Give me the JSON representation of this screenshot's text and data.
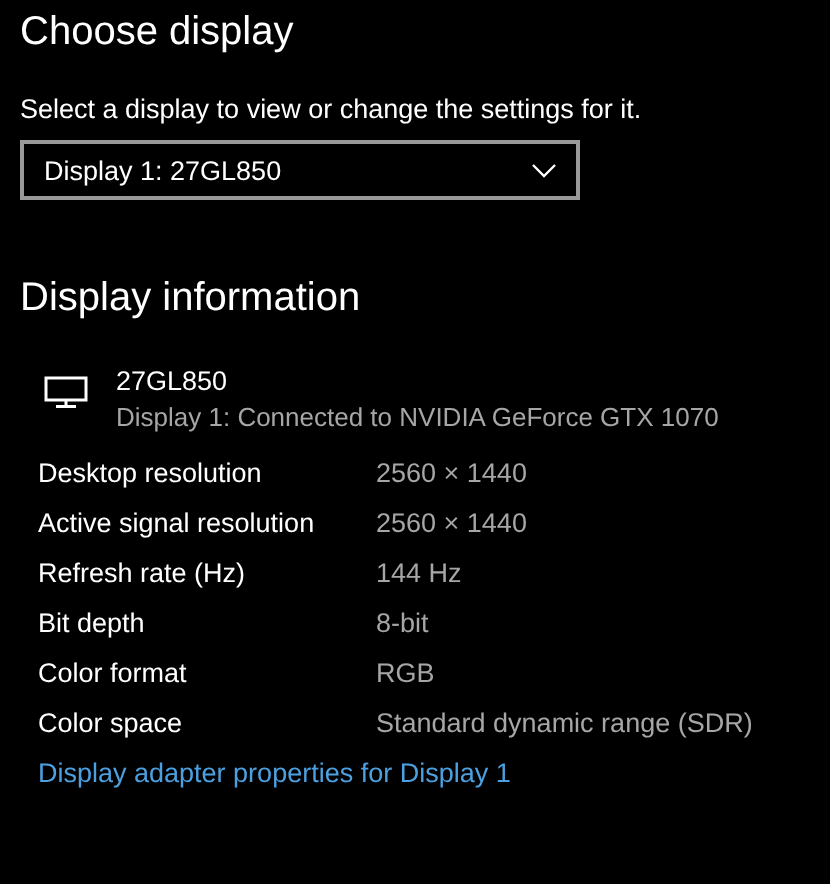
{
  "choose_display": {
    "title": "Choose display",
    "description": "Select a display to view or change the settings for it.",
    "dropdown": {
      "value": "Display 1: 27GL850"
    }
  },
  "display_information": {
    "title": "Display information",
    "monitor": {
      "name": "27GL850",
      "connection": "Display 1: Connected to NVIDIA GeForce GTX 1070"
    },
    "rows": [
      {
        "label": "Desktop resolution",
        "value": "2560 × 1440"
      },
      {
        "label": "Active signal resolution",
        "value": "2560 × 1440"
      },
      {
        "label": "Refresh rate (Hz)",
        "value": "144 Hz"
      },
      {
        "label": "Bit depth",
        "value": "8-bit"
      },
      {
        "label": "Color format",
        "value": "RGB"
      },
      {
        "label": "Color space",
        "value": "Standard dynamic range (SDR)"
      }
    ],
    "link": "Display adapter properties for Display 1"
  }
}
